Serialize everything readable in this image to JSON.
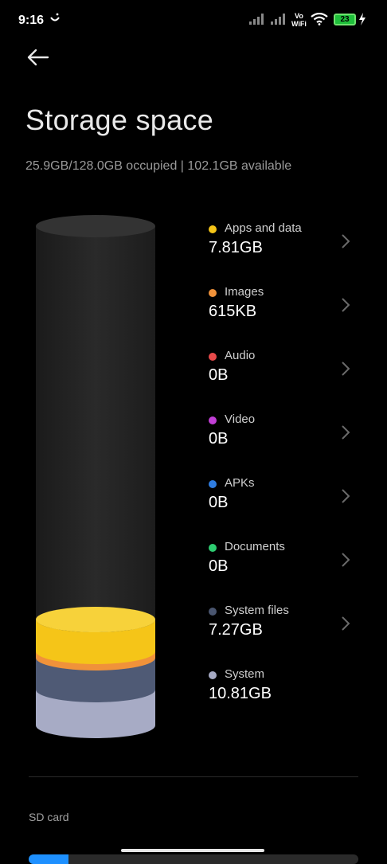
{
  "status_bar": {
    "time": "9:16",
    "vowifi_top": "Vo",
    "vowifi_bottom": "WiFi",
    "battery": "23"
  },
  "page": {
    "title": "Storage space",
    "summary": "25.9GB/128.0GB occupied | 102.1GB available"
  },
  "categories": [
    {
      "label": "Apps and data",
      "value": "7.81GB",
      "color": "#f5c518",
      "chevron": true
    },
    {
      "label": "Images",
      "value": "615KB",
      "color": "#f0923a",
      "chevron": true
    },
    {
      "label": "Audio",
      "value": "0B",
      "color": "#e84a4a",
      "chevron": true
    },
    {
      "label": "Video",
      "value": "0B",
      "color": "#c23fd6",
      "chevron": true
    },
    {
      "label": "APKs",
      "value": "0B",
      "color": "#2f7de1",
      "chevron": true
    },
    {
      "label": "Documents",
      "value": "0B",
      "color": "#2ecc71",
      "chevron": true
    },
    {
      "label": "System files",
      "value": "7.27GB",
      "color": "#4a5670",
      "chevron": true
    },
    {
      "label": "System",
      "value": "10.81GB",
      "color": "#a7abc5",
      "chevron": false
    }
  ],
  "sd_card": {
    "label": "SD card",
    "fill_fraction": 0.12
  }
}
